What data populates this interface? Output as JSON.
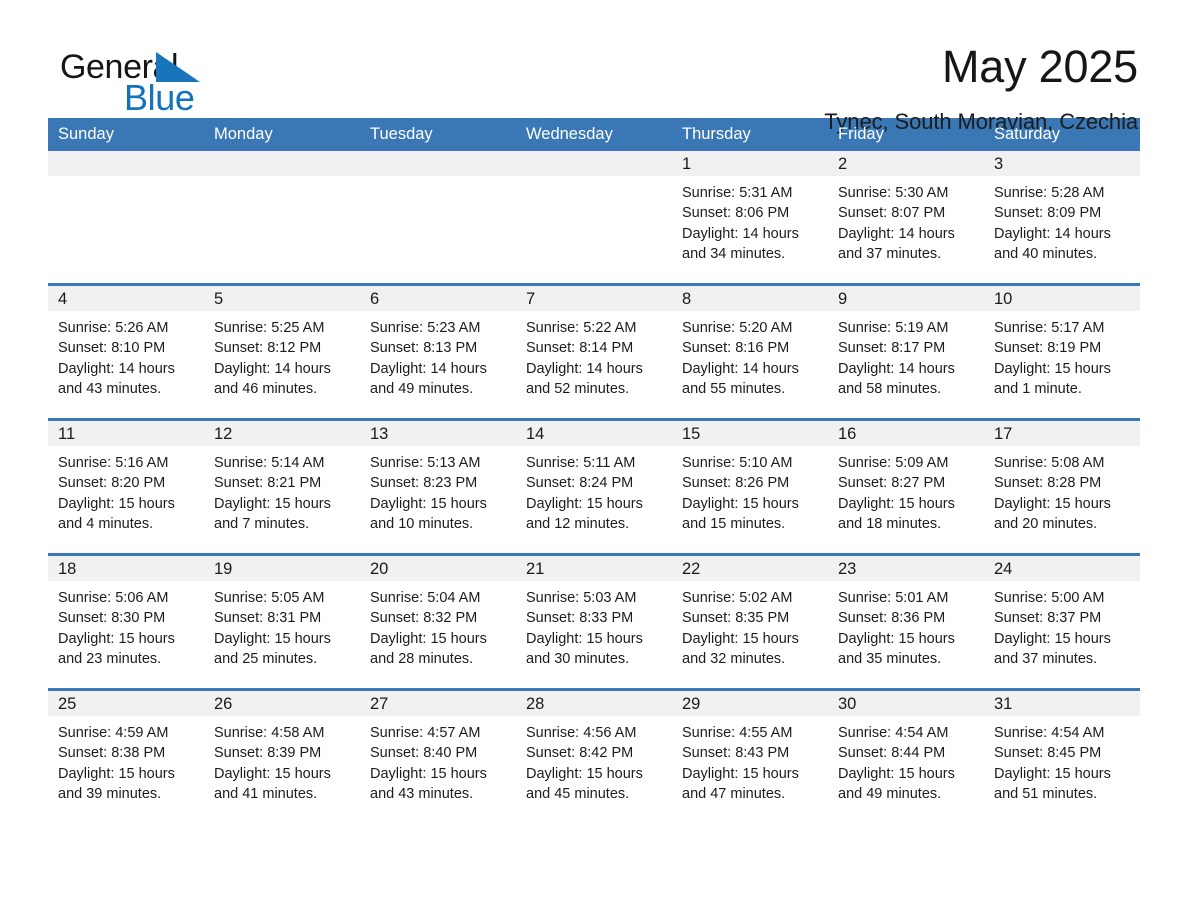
{
  "brand": {
    "word_one": "General",
    "word_two": "Blue",
    "accent_color": "#1272bb",
    "triangle_color": "#1874bb"
  },
  "header": {
    "month_title": "May 2025",
    "location": "Tynec, South Moravian, Czechia"
  },
  "calendar": {
    "header_color": "#3a77b5",
    "daynum_band_color": "#f1f1f1",
    "weekday_headers": [
      "Sunday",
      "Monday",
      "Tuesday",
      "Wednesday",
      "Thursday",
      "Friday",
      "Saturday"
    ],
    "weeks": [
      [
        {
          "day": "",
          "sunrise": "",
          "sunset": "",
          "daylight_line1": "",
          "daylight_line2": ""
        },
        {
          "day": "",
          "sunrise": "",
          "sunset": "",
          "daylight_line1": "",
          "daylight_line2": ""
        },
        {
          "day": "",
          "sunrise": "",
          "sunset": "",
          "daylight_line1": "",
          "daylight_line2": ""
        },
        {
          "day": "",
          "sunrise": "",
          "sunset": "",
          "daylight_line1": "",
          "daylight_line2": ""
        },
        {
          "day": "1",
          "sunrise": "Sunrise: 5:31 AM",
          "sunset": "Sunset: 8:06 PM",
          "daylight_line1": "Daylight: 14 hours",
          "daylight_line2": "and 34 minutes."
        },
        {
          "day": "2",
          "sunrise": "Sunrise: 5:30 AM",
          "sunset": "Sunset: 8:07 PM",
          "daylight_line1": "Daylight: 14 hours",
          "daylight_line2": "and 37 minutes."
        },
        {
          "day": "3",
          "sunrise": "Sunrise: 5:28 AM",
          "sunset": "Sunset: 8:09 PM",
          "daylight_line1": "Daylight: 14 hours",
          "daylight_line2": "and 40 minutes."
        }
      ],
      [
        {
          "day": "4",
          "sunrise": "Sunrise: 5:26 AM",
          "sunset": "Sunset: 8:10 PM",
          "daylight_line1": "Daylight: 14 hours",
          "daylight_line2": "and 43 minutes."
        },
        {
          "day": "5",
          "sunrise": "Sunrise: 5:25 AM",
          "sunset": "Sunset: 8:12 PM",
          "daylight_line1": "Daylight: 14 hours",
          "daylight_line2": "and 46 minutes."
        },
        {
          "day": "6",
          "sunrise": "Sunrise: 5:23 AM",
          "sunset": "Sunset: 8:13 PM",
          "daylight_line1": "Daylight: 14 hours",
          "daylight_line2": "and 49 minutes."
        },
        {
          "day": "7",
          "sunrise": "Sunrise: 5:22 AM",
          "sunset": "Sunset: 8:14 PM",
          "daylight_line1": "Daylight: 14 hours",
          "daylight_line2": "and 52 minutes."
        },
        {
          "day": "8",
          "sunrise": "Sunrise: 5:20 AM",
          "sunset": "Sunset: 8:16 PM",
          "daylight_line1": "Daylight: 14 hours",
          "daylight_line2": "and 55 minutes."
        },
        {
          "day": "9",
          "sunrise": "Sunrise: 5:19 AM",
          "sunset": "Sunset: 8:17 PM",
          "daylight_line1": "Daylight: 14 hours",
          "daylight_line2": "and 58 minutes."
        },
        {
          "day": "10",
          "sunrise": "Sunrise: 5:17 AM",
          "sunset": "Sunset: 8:19 PM",
          "daylight_line1": "Daylight: 15 hours",
          "daylight_line2": "and 1 minute."
        }
      ],
      [
        {
          "day": "11",
          "sunrise": "Sunrise: 5:16 AM",
          "sunset": "Sunset: 8:20 PM",
          "daylight_line1": "Daylight: 15 hours",
          "daylight_line2": "and 4 minutes."
        },
        {
          "day": "12",
          "sunrise": "Sunrise: 5:14 AM",
          "sunset": "Sunset: 8:21 PM",
          "daylight_line1": "Daylight: 15 hours",
          "daylight_line2": "and 7 minutes."
        },
        {
          "day": "13",
          "sunrise": "Sunrise: 5:13 AM",
          "sunset": "Sunset: 8:23 PM",
          "daylight_line1": "Daylight: 15 hours",
          "daylight_line2": "and 10 minutes."
        },
        {
          "day": "14",
          "sunrise": "Sunrise: 5:11 AM",
          "sunset": "Sunset: 8:24 PM",
          "daylight_line1": "Daylight: 15 hours",
          "daylight_line2": "and 12 minutes."
        },
        {
          "day": "15",
          "sunrise": "Sunrise: 5:10 AM",
          "sunset": "Sunset: 8:26 PM",
          "daylight_line1": "Daylight: 15 hours",
          "daylight_line2": "and 15 minutes."
        },
        {
          "day": "16",
          "sunrise": "Sunrise: 5:09 AM",
          "sunset": "Sunset: 8:27 PM",
          "daylight_line1": "Daylight: 15 hours",
          "daylight_line2": "and 18 minutes."
        },
        {
          "day": "17",
          "sunrise": "Sunrise: 5:08 AM",
          "sunset": "Sunset: 8:28 PM",
          "daylight_line1": "Daylight: 15 hours",
          "daylight_line2": "and 20 minutes."
        }
      ],
      [
        {
          "day": "18",
          "sunrise": "Sunrise: 5:06 AM",
          "sunset": "Sunset: 8:30 PM",
          "daylight_line1": "Daylight: 15 hours",
          "daylight_line2": "and 23 minutes."
        },
        {
          "day": "19",
          "sunrise": "Sunrise: 5:05 AM",
          "sunset": "Sunset: 8:31 PM",
          "daylight_line1": "Daylight: 15 hours",
          "daylight_line2": "and 25 minutes."
        },
        {
          "day": "20",
          "sunrise": "Sunrise: 5:04 AM",
          "sunset": "Sunset: 8:32 PM",
          "daylight_line1": "Daylight: 15 hours",
          "daylight_line2": "and 28 minutes."
        },
        {
          "day": "21",
          "sunrise": "Sunrise: 5:03 AM",
          "sunset": "Sunset: 8:33 PM",
          "daylight_line1": "Daylight: 15 hours",
          "daylight_line2": "and 30 minutes."
        },
        {
          "day": "22",
          "sunrise": "Sunrise: 5:02 AM",
          "sunset": "Sunset: 8:35 PM",
          "daylight_line1": "Daylight: 15 hours",
          "daylight_line2": "and 32 minutes."
        },
        {
          "day": "23",
          "sunrise": "Sunrise: 5:01 AM",
          "sunset": "Sunset: 8:36 PM",
          "daylight_line1": "Daylight: 15 hours",
          "daylight_line2": "and 35 minutes."
        },
        {
          "day": "24",
          "sunrise": "Sunrise: 5:00 AM",
          "sunset": "Sunset: 8:37 PM",
          "daylight_line1": "Daylight: 15 hours",
          "daylight_line2": "and 37 minutes."
        }
      ],
      [
        {
          "day": "25",
          "sunrise": "Sunrise: 4:59 AM",
          "sunset": "Sunset: 8:38 PM",
          "daylight_line1": "Daylight: 15 hours",
          "daylight_line2": "and 39 minutes."
        },
        {
          "day": "26",
          "sunrise": "Sunrise: 4:58 AM",
          "sunset": "Sunset: 8:39 PM",
          "daylight_line1": "Daylight: 15 hours",
          "daylight_line2": "and 41 minutes."
        },
        {
          "day": "27",
          "sunrise": "Sunrise: 4:57 AM",
          "sunset": "Sunset: 8:40 PM",
          "daylight_line1": "Daylight: 15 hours",
          "daylight_line2": "and 43 minutes."
        },
        {
          "day": "28",
          "sunrise": "Sunrise: 4:56 AM",
          "sunset": "Sunset: 8:42 PM",
          "daylight_line1": "Daylight: 15 hours",
          "daylight_line2": "and 45 minutes."
        },
        {
          "day": "29",
          "sunrise": "Sunrise: 4:55 AM",
          "sunset": "Sunset: 8:43 PM",
          "daylight_line1": "Daylight: 15 hours",
          "daylight_line2": "and 47 minutes."
        },
        {
          "day": "30",
          "sunrise": "Sunrise: 4:54 AM",
          "sunset": "Sunset: 8:44 PM",
          "daylight_line1": "Daylight: 15 hours",
          "daylight_line2": "and 49 minutes."
        },
        {
          "day": "31",
          "sunrise": "Sunrise: 4:54 AM",
          "sunset": "Sunset: 8:45 PM",
          "daylight_line1": "Daylight: 15 hours",
          "daylight_line2": "and 51 minutes."
        }
      ]
    ]
  }
}
